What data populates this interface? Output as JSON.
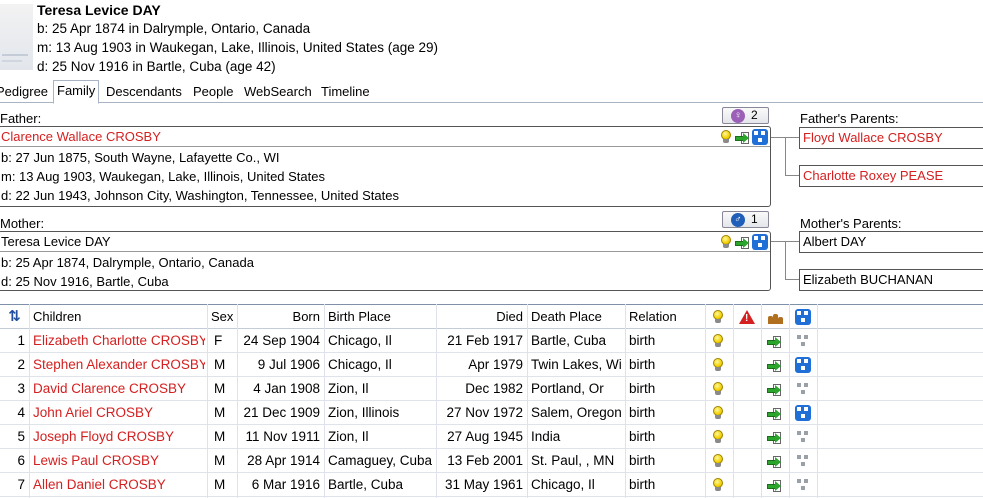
{
  "header": {
    "name": "Teresa Levice DAY",
    "birth": "b: 25 Apr 1874 in Dalrymple, Ontario, Canada",
    "marriage": "m: 13 Aug 1903 in Waukegan, Lake, Illinois, United States (age 29)",
    "death": "d: 25 Nov 1916 in Bartle, Cuba (age 42)"
  },
  "tabs": [
    "Pedigree",
    "Family",
    "Descendants",
    "People",
    "WebSearch",
    "Timeline"
  ],
  "active_tab": "Family",
  "father": {
    "label": "Father:",
    "spouse_count": "2",
    "name": "Clarence Wallace CROSBY",
    "birth": "b: 27 Jun 1875, South Wayne, Lafayette Co., WI",
    "marriage": "m: 13 Aug 1903, Waukegan, Lake, Illinois, United States",
    "death": "d: 22 Jun 1943, Johnson City, Washington, Tennessee, United States"
  },
  "mother": {
    "label": "Mother:",
    "spouse_count": "1",
    "name": "Teresa Levice DAY",
    "birth": "b: 25 Apr 1874, Dalrymple, Ontario, Canada",
    "death": "d: 25 Nov 1916, Bartle, Cuba"
  },
  "fathers_parents": {
    "label": "Father's Parents:",
    "father": "Floyd Wallace CROSBY",
    "mother": "Charlotte Roxey PEASE"
  },
  "mothers_parents": {
    "label": "Mother's Parents:",
    "father": "Albert DAY",
    "mother": "Elizabeth BUCHANAN"
  },
  "children_table": {
    "columns": [
      "Children",
      "Sex",
      "Born",
      "Birth Place",
      "Died",
      "Death Place",
      "Relation"
    ],
    "sort_icon": "sort-arrows-icon",
    "rows": [
      {
        "num": "1",
        "name": "Elizabeth Charlotte CROSBY",
        "sex": "F",
        "born": "24 Sep 1904",
        "birth_place": "Chicago, Il",
        "died": "21 Feb 1917",
        "death_place": "Bartle, Cuba",
        "relation": "birth",
        "tree_active": false
      },
      {
        "num": "2",
        "name": "Stephen Alexander CROSBY",
        "sex": "M",
        "born": "9 Jul 1906",
        "birth_place": "Chicago, Il",
        "died": "Apr 1979",
        "death_place": "Twin Lakes, Wi",
        "relation": "birth",
        "tree_active": true
      },
      {
        "num": "3",
        "name": "David Clarence CROSBY",
        "sex": "M",
        "born": "4 Jan 1908",
        "birth_place": "Zion, Il",
        "died": "Dec 1982",
        "death_place": "Portland, Or",
        "relation": "birth",
        "tree_active": false
      },
      {
        "num": "4",
        "name": "John Ariel CROSBY",
        "sex": "M",
        "born": "21 Dec 1909",
        "birth_place": "Zion, Illinois",
        "died": "27 Nov 1972",
        "death_place": "Salem, Oregon",
        "relation": "birth",
        "tree_active": true
      },
      {
        "num": "5",
        "name": "Joseph Floyd CROSBY",
        "sex": "M",
        "born": "11 Nov 1911",
        "birth_place": "Zion, Il",
        "died": "27 Aug 1945",
        "death_place": "India",
        "relation": "birth",
        "tree_active": false
      },
      {
        "num": "6",
        "name": "Lewis Paul CROSBY",
        "sex": "M",
        "born": "28 Apr 1914",
        "birth_place": "Camaguey, Cuba",
        "died": "13 Feb 2001",
        "death_place": "St. Paul, , MN",
        "relation": "birth",
        "tree_active": false
      },
      {
        "num": "7",
        "name": "Allen Daniel CROSBY",
        "sex": "M",
        "born": "6 Mar 1916",
        "birth_place": "Bartle, Cuba",
        "died": "31 May 1961",
        "death_place": "Chicago, Il",
        "relation": "birth",
        "tree_active": false
      }
    ]
  },
  "colors": {
    "link_red": "#d42020",
    "tree_blue": "#1f6fd6",
    "male_blue": "#1f5fb8",
    "female_purple": "#9b5fb8"
  }
}
